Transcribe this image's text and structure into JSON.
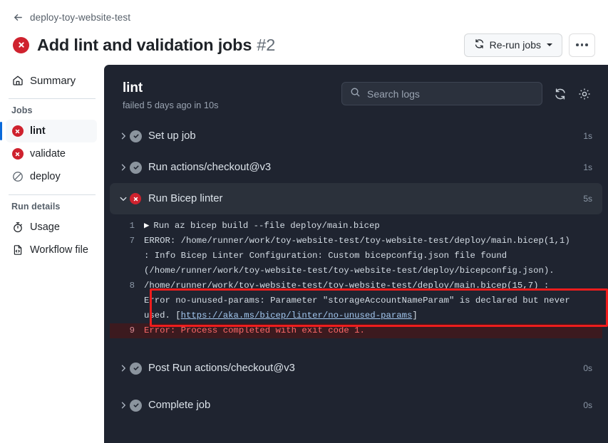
{
  "header": {
    "back_icon": "arrow-left-icon",
    "breadcrumb": "deploy-toy-website-test",
    "status_icon": "failure-icon",
    "title": "Add lint and validation jobs",
    "run_number": "#2",
    "rerun_button": {
      "label": "Re-run jobs",
      "icon": "sync-icon",
      "caret": "chevron-down-icon"
    },
    "more_button": {
      "icon": "kebab-horizontal-icon"
    }
  },
  "sidebar": {
    "summary": {
      "label": "Summary",
      "icon": "home-icon"
    },
    "jobs_heading": "Jobs",
    "jobs": [
      {
        "label": "lint",
        "status": "failure",
        "selected": true
      },
      {
        "label": "validate",
        "status": "failure",
        "selected": false
      },
      {
        "label": "deploy",
        "status": "skipped",
        "selected": false
      }
    ],
    "run_details_heading": "Run details",
    "run_details": [
      {
        "label": "Usage",
        "icon": "stopwatch-icon"
      },
      {
        "label": "Workflow file",
        "icon": "file-code-icon"
      }
    ]
  },
  "log_panel": {
    "title": "lint",
    "subtitle": "failed 5 days ago in 10s",
    "search": {
      "placeholder": "Search logs",
      "value": "",
      "icon": "search-icon"
    },
    "refresh_icon": "sync-icon",
    "settings_icon": "gear-icon",
    "steps": [
      {
        "label": "Set up job",
        "status": "success",
        "duration": "1s",
        "expanded": false
      },
      {
        "label": "Run actions/checkout@v3",
        "status": "success",
        "duration": "1s",
        "expanded": false
      },
      {
        "label": "Run Bicep linter",
        "status": "failure",
        "duration": "5s",
        "expanded": true
      },
      {
        "label": "Post Run actions/checkout@v3",
        "status": "success",
        "duration": "0s",
        "expanded": false
      },
      {
        "label": "Complete job",
        "status": "success",
        "duration": "0s",
        "expanded": false
      }
    ],
    "log_lines": [
      {
        "number": "1",
        "text": "Run az bicep build --file deploy/main.bicep",
        "marker": "▶",
        "error": false
      },
      {
        "number": "7",
        "text": "ERROR: /home/runner/work/toy-website-test/toy-website-test/deploy/main.bicep(1,1)",
        "error": false
      },
      {
        "number": "",
        "text": ": Info Bicep Linter Configuration: Custom bicepconfig.json file found",
        "error": false
      },
      {
        "number": "",
        "text": "(/home/runner/work/toy-website-test/toy-website-test/deploy/bicepconfig.json).",
        "error": false
      },
      {
        "number": "8",
        "text": "/home/runner/work/toy-website-test/toy-website-test/deploy/main.bicep(15,7) :",
        "error": false
      },
      {
        "number": "",
        "text": "Error no-unused-params: Parameter \"storageAccountNameParam\" is declared but never",
        "error": false
      },
      {
        "number": "",
        "text": "used. [",
        "link": "https://aka.ms/bicep/linter/no-unused-params",
        "text_after": "]",
        "error": false
      },
      {
        "number": "9",
        "text": "Error: Process completed with exit code 1.",
        "error": true
      }
    ],
    "annotation": {
      "color": "#ee1d1d",
      "label": "error-highlight-box"
    }
  }
}
